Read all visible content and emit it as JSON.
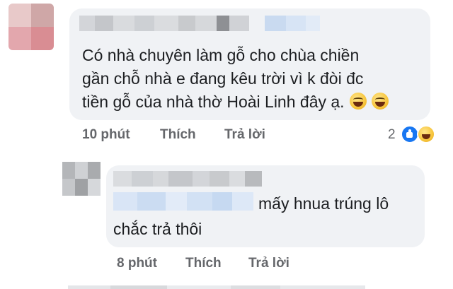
{
  "colors": {
    "bubble_bg": "#f0f2f5",
    "text": "#1c1e21",
    "meta": "#65676b",
    "like_blue": "#1877f2"
  },
  "comment1": {
    "text_lines": [
      "Có nhà chuyên làm gỗ cho chùa chiền",
      "gần chỗ nhà e đang kêu trời vì k đòi đc",
      "tiền gỗ của nhà thờ Hoài Linh đây ạ."
    ],
    "emojis": [
      "grinning-sweat-emoji",
      "grinning-sweat-emoji"
    ],
    "time": "10 phút",
    "like_label": "Thích",
    "reply_label": "Trả lời",
    "reaction_count": "2",
    "reactions": [
      "like-icon",
      "haha-icon"
    ]
  },
  "comment2": {
    "text_line1": "mấy hnua trúng lô",
    "text_line2": "chắc trả thôi",
    "time": "8 phút",
    "like_label": "Thích",
    "reply_label": "Trả lời"
  }
}
